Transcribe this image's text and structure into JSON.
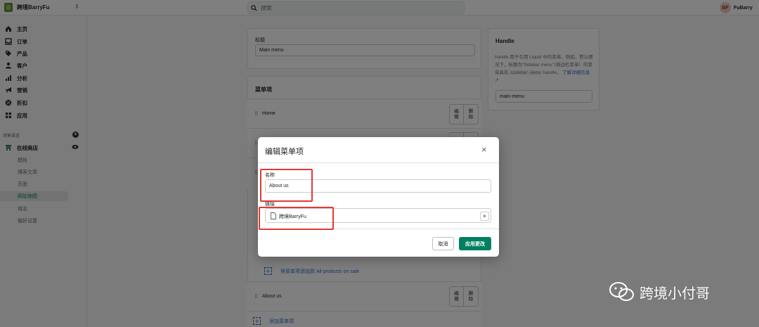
{
  "topbar": {
    "store_name": "跨境BarryFu",
    "search_placeholder": "搜索",
    "user_initials": "BF",
    "user_name": "FuBarry"
  },
  "sidebar": {
    "items": [
      {
        "label": "主页",
        "icon": "home-icon"
      },
      {
        "label": "订单",
        "icon": "orders-icon"
      },
      {
        "label": "产品",
        "icon": "tag-icon"
      },
      {
        "label": "客户",
        "icon": "person-icon"
      },
      {
        "label": "分析",
        "icon": "bar-chart-icon"
      },
      {
        "label": "营销",
        "icon": "megaphone-icon"
      },
      {
        "label": "折扣",
        "icon": "discount-icon"
      },
      {
        "label": "应用",
        "icon": "apps-icon"
      }
    ],
    "channels_label": "销售渠道",
    "online_store": "在线商店",
    "sub_items": [
      "模板",
      "博客文章",
      "页面",
      "网站地图",
      "域名",
      "偏好设置"
    ],
    "active_sub": "网站地图"
  },
  "main": {
    "title_label": "标题",
    "title_value": "Main menu",
    "menu_items_heading": "菜单项",
    "rows": [
      {
        "label": "Home"
      },
      {
        "label": "About us"
      }
    ],
    "edit_label": "编辑",
    "delete_label": "删除",
    "add_to_collection": "将菜单项添加到 All products on sale",
    "add_menu_item": "添加菜单项"
  },
  "handle": {
    "title": "Handle",
    "desc_1": "handle 用于引用 Liquid 中的菜单。例如，默认情况下，标题为“Sidebar menu”（侧边栏菜单）的菜单具有",
    "desc_code": "sidebar-menu",
    "desc_2": "handle。",
    "learn_more": "了解详细信息",
    "value": "main-menu"
  },
  "modal": {
    "title": "编辑菜单项",
    "name_label": "名称",
    "name_value": "About us",
    "link_label": "链接",
    "link_value": "跨境BarryFu",
    "cancel_label": "取消",
    "apply_label": "应用更改"
  },
  "watermark": {
    "text": "跨境小付哥"
  },
  "colors": {
    "primary": "#008060",
    "highlight": "#e53935",
    "link": "#2c6ecb"
  }
}
